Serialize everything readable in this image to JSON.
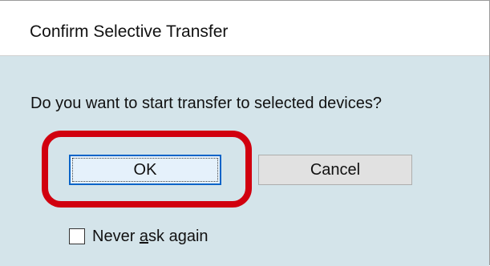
{
  "dialog": {
    "title": "Confirm Selective Transfer",
    "message": "Do you want to start transfer to selected devices?",
    "ok_label": "OK",
    "cancel_label": "Cancel",
    "never_ask": {
      "label_before": "Never ",
      "label_accel": "a",
      "label_after": "sk again",
      "checked": false
    }
  },
  "colors": {
    "client_background": "#d4e4ea",
    "highlight": "#d1000f",
    "focus_border": "#0a64c8"
  }
}
